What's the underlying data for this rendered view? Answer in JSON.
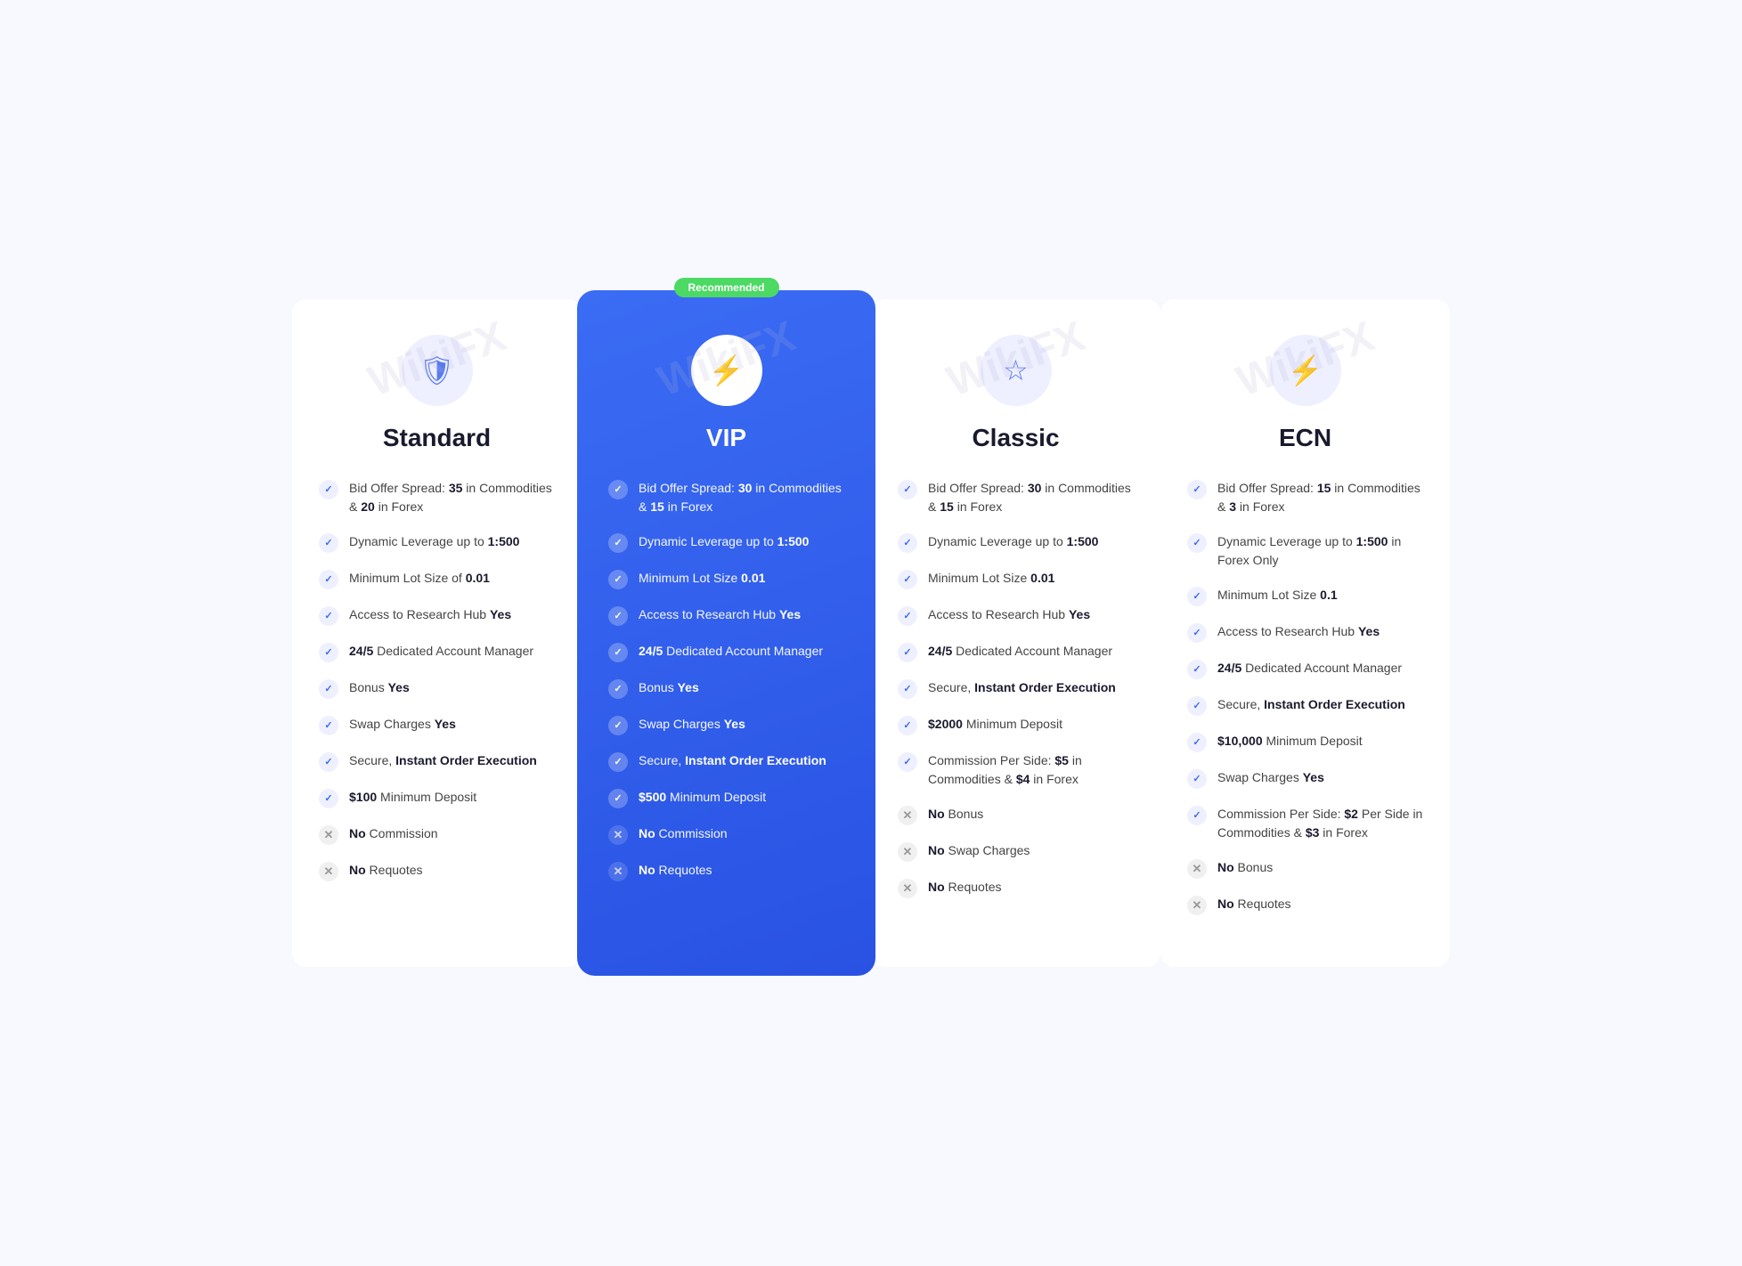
{
  "recommended_label": "Recommended",
  "plans": [
    {
      "id": "standard",
      "title": "Standard",
      "icon": "🛡",
      "icon_name": "shield-icon",
      "is_vip": false,
      "features": [
        {
          "type": "check",
          "text": "Bid Offer Spread: <strong>35</strong> in Commodities & <strong>20</strong> in Forex"
        },
        {
          "type": "check",
          "text": "Dynamic Leverage up to <strong>1:500</strong>"
        },
        {
          "type": "check",
          "text": "Minimum Lot Size of <strong>0.01</strong>"
        },
        {
          "type": "check",
          "text": "Access to Research Hub <strong>Yes</strong>"
        },
        {
          "type": "check",
          "text": "<strong>24/5</strong> Dedicated Account Manager"
        },
        {
          "type": "check",
          "text": "Bonus <strong>Yes</strong>"
        },
        {
          "type": "check",
          "text": "Swap Charges <strong>Yes</strong>"
        },
        {
          "type": "check",
          "text": "Secure, <strong>Instant Order Execution</strong>"
        },
        {
          "type": "check",
          "text": "<strong>$100</strong> Minimum Deposit"
        },
        {
          "type": "cross",
          "text": "<strong>No</strong> Commission"
        },
        {
          "type": "cross",
          "text": "<strong>No</strong> Requotes"
        }
      ]
    },
    {
      "id": "vip",
      "title": "VIP",
      "icon": "⚡",
      "icon_name": "lightning-icon",
      "is_vip": true,
      "features": [
        {
          "type": "check",
          "text": "Bid Offer Spread: <strong>30</strong> in Commodities & <strong>15</strong> in Forex"
        },
        {
          "type": "check",
          "text": "Dynamic Leverage up to <strong>1:500</strong>"
        },
        {
          "type": "check",
          "text": "Minimum Lot Size <strong>0.01</strong>"
        },
        {
          "type": "check",
          "text": "Access to Research Hub <strong>Yes</strong>"
        },
        {
          "type": "check",
          "text": "<strong>24/5</strong> Dedicated Account Manager"
        },
        {
          "type": "check",
          "text": "Bonus <strong>Yes</strong>"
        },
        {
          "type": "check",
          "text": "Swap Charges <strong>Yes</strong>"
        },
        {
          "type": "check",
          "text": "Secure, <strong>Instant Order Execution</strong>"
        },
        {
          "type": "check",
          "text": "<strong>$500</strong> Minimum Deposit"
        },
        {
          "type": "cross",
          "text": "<strong>No</strong> Commission"
        },
        {
          "type": "cross",
          "text": "<strong>No</strong> Requotes"
        }
      ]
    },
    {
      "id": "classic",
      "title": "Classic",
      "icon": "☆",
      "icon_name": "star-icon",
      "is_vip": false,
      "features": [
        {
          "type": "check",
          "text": "Bid Offer Spread: <strong>30</strong> in Commodities & <strong>15</strong> in Forex"
        },
        {
          "type": "check",
          "text": "Dynamic Leverage up to <strong>1:500</strong>"
        },
        {
          "type": "check",
          "text": "Minimum Lot Size <strong>0.01</strong>"
        },
        {
          "type": "check",
          "text": "Access to Research Hub <strong>Yes</strong>"
        },
        {
          "type": "check",
          "text": "<strong>24/5</strong> Dedicated Account Manager"
        },
        {
          "type": "check",
          "text": "Secure, <strong>Instant Order Execution</strong>"
        },
        {
          "type": "check",
          "text": "<strong>$2000</strong> Minimum Deposit"
        },
        {
          "type": "check",
          "text": "Commission Per Side: <strong>$5</strong> in Commodities & <strong>$4</strong> in Forex"
        },
        {
          "type": "cross",
          "text": "<strong>No</strong> Bonus"
        },
        {
          "type": "cross",
          "text": "<strong>No</strong> Swap Charges"
        },
        {
          "type": "cross",
          "text": "<strong>No</strong> Requotes"
        }
      ]
    },
    {
      "id": "ecn",
      "title": "ECN",
      "icon": "⚡",
      "icon_name": "lightning-icon",
      "is_vip": false,
      "features": [
        {
          "type": "check",
          "text": "Bid Offer Spread: <strong>15</strong> in Commodities & <strong>3</strong> in Forex"
        },
        {
          "type": "check",
          "text": "Dynamic Leverage up to <strong>1:500</strong> in Forex Only"
        },
        {
          "type": "check",
          "text": "Minimum Lot Size <strong>0.1</strong>"
        },
        {
          "type": "check",
          "text": "Access to Research Hub <strong>Yes</strong>"
        },
        {
          "type": "check",
          "text": "<strong>24/5</strong> Dedicated Account Manager"
        },
        {
          "type": "check",
          "text": "Secure, <strong>Instant Order Execution</strong>"
        },
        {
          "type": "check",
          "text": "<strong>$10,000</strong> Minimum Deposit"
        },
        {
          "type": "check",
          "text": "Swap Charges <strong>Yes</strong>"
        },
        {
          "type": "check",
          "text": "Commission Per Side: <strong>$2</strong> Per Side in Commodities & <strong>$3</strong> in Forex"
        },
        {
          "type": "cross",
          "text": "<strong>No</strong> Bonus"
        },
        {
          "type": "cross",
          "text": "<strong>No</strong> Requotes"
        }
      ]
    }
  ]
}
